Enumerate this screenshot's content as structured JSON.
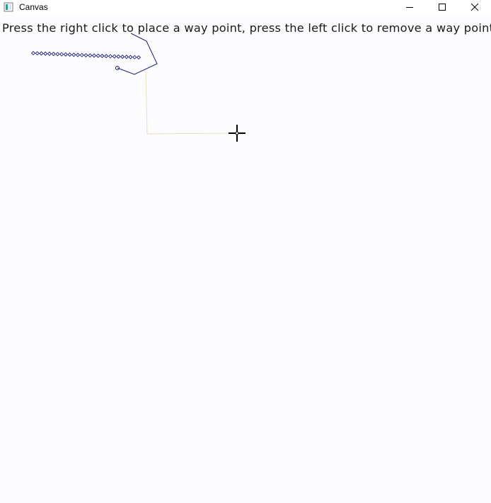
{
  "window": {
    "title": "Canvas",
    "minimize_icon": "minimize-icon",
    "maximize_icon": "maximize-icon",
    "close_icon": "close-icon"
  },
  "canvas": {
    "instruction": "Press the right click to place a way point, press the left click to remove a way point",
    "background_color": "#fcfcff",
    "path_color": "#1c1c7a",
    "guide_color": "#e8e0b0",
    "cursor_icon": "crosshair-cursor-icon"
  }
}
